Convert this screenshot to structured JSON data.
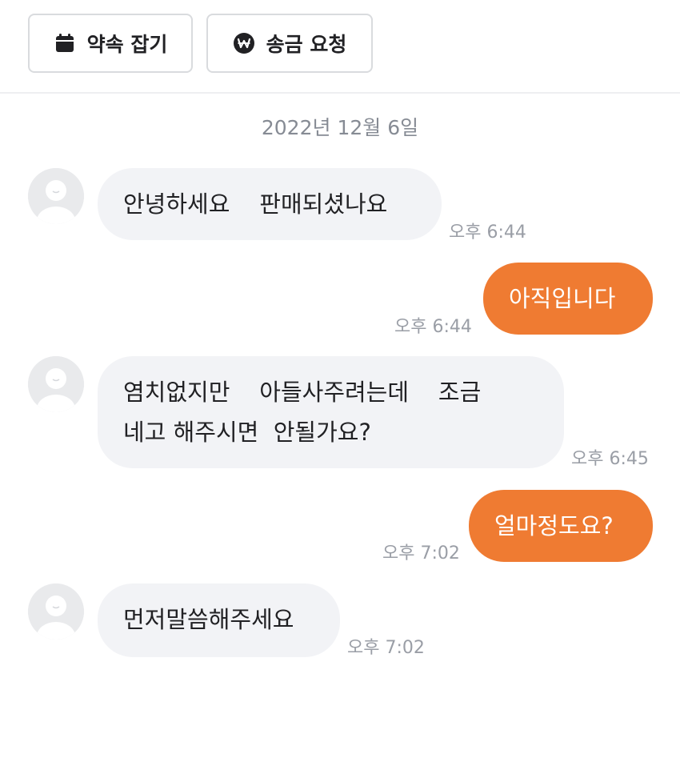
{
  "toolbar": {
    "appointment_label": "약속 잡기",
    "appointment_icon": "calendar-icon",
    "remit_label": "송금 요청",
    "remit_icon": "won-icon"
  },
  "chat": {
    "date": "2022년 12월 6일",
    "messages": [
      {
        "direction": "incoming",
        "text": "안녕하세요    판매되셨나요",
        "time": "오후 6:44"
      },
      {
        "direction": "outgoing",
        "text": "아직입니다",
        "time": "오후 6:44"
      },
      {
        "direction": "incoming",
        "text": "염치없지만    아들사주려는데    조금\n네고 해주시면  안될가요?",
        "time": "오후 6:45"
      },
      {
        "direction": "outgoing",
        "text": "얼마정도요?",
        "time": "오후 7:02"
      },
      {
        "direction": "incoming",
        "text": "먼저말씀해주세요",
        "time": "오후 7:02"
      }
    ]
  },
  "colors": {
    "outgoing_bubble": "#ef7b32",
    "incoming_bubble": "#f2f3f6",
    "timestamp": "#9a9ea6"
  }
}
